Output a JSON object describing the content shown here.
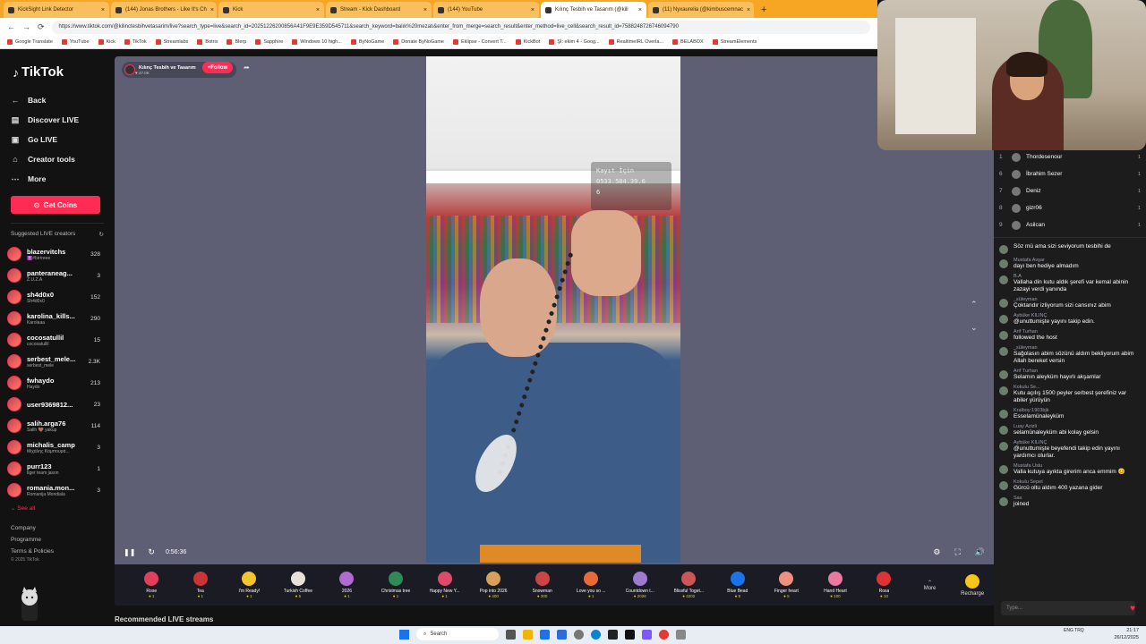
{
  "browser": {
    "tabs": [
      {
        "label": "KickSight Link Detector",
        "active": false
      },
      {
        "label": "(144) Jonas Brothers - Like It's Ch",
        "active": false
      },
      {
        "label": "Kick",
        "active": false
      },
      {
        "label": "Stream - Kick Dashboard",
        "active": false
      },
      {
        "label": "(144) YouTube",
        "active": false
      },
      {
        "label": "Kılınç Tesbih ve Tasarım (@kili",
        "active": true
      },
      {
        "label": "(11) Nyxaurelia (@kimbuscemnac",
        "active": false
      }
    ],
    "url": "https://www.tiktok.com/@kilinctesbihvetasarim/live?search_type=live&search_id=20251226200856A41F9E9E359D545711&search_keyword=balık%20mezatı&enter_from_merge=search_result&enter_method=live_cell&search_result_id=7588248726746094790",
    "bookmarks": [
      "Google Translate",
      "YouTube",
      "Kick",
      "TikTok",
      "Streamlabs",
      "Botrix",
      "Blerp",
      "Sapphire",
      "Windows 10 high...",
      "ByNoGame",
      "Donate ByNoGame",
      "Eklipse - Convert T...",
      "KickBot",
      "Şİ: ekim 4 - Goog...",
      "RealtimeIRL Overla...",
      "BELABOX",
      "StreamElements"
    ]
  },
  "sidebar": {
    "logo": "TikTok",
    "nav": [
      {
        "label": "Back",
        "icon": "arrow-left-icon",
        "glyph": "←"
      },
      {
        "label": "Discover LIVE",
        "icon": "live-icon",
        "glyph": "▤"
      },
      {
        "label": "Go LIVE",
        "icon": "camera-icon",
        "glyph": "▣"
      },
      {
        "label": "Creator tools",
        "icon": "home-icon",
        "glyph": "⌂"
      },
      {
        "label": "More",
        "icon": "more-icon",
        "glyph": "⋯"
      }
    ],
    "get_coins": "Get Coins",
    "suggested_title": "Suggested LIVE creators",
    "creators": [
      {
        "name": "blazervitchs",
        "sub": "✝️#birrreee",
        "count": "328"
      },
      {
        "name": "panteraneag...",
        "sub": "Z.U.Z.A",
        "count": "3"
      },
      {
        "name": "sh4d0x0",
        "sub": "Sh4d0x0",
        "count": "152"
      },
      {
        "name": "karolina_kills...",
        "sub": "Karolaaa",
        "count": "290"
      },
      {
        "name": "cocosatullil",
        "sub": "cocosatullil",
        "count": "15"
      },
      {
        "name": "serbest_mele...",
        "sub": "serbest_mele",
        "count": "2.3K"
      },
      {
        "name": "fwhaydo",
        "sub": "Haydo",
        "count": "213"
      },
      {
        "name": "user9369812...",
        "sub": "",
        "count": "23"
      },
      {
        "name": "salih.arga76",
        "sub": "Salih 🤎 yakup",
        "count": "114"
      },
      {
        "name": "michalis_camp",
        "sub": "Μιχάλης Καμπουρά...",
        "count": "3"
      },
      {
        "name": "purr123",
        "sub": "tiger team jason",
        "count": "1"
      },
      {
        "name": "romania.mon...",
        "sub": "Romanija Mondiala",
        "count": "3"
      }
    ],
    "see_all": "See all",
    "footer": [
      "Company",
      "Programme",
      "Terms & Policies"
    ],
    "copyright": "© 2025 TikTok"
  },
  "player": {
    "host_name": "Kılınç Tesbih ve Tasarım",
    "host_likes": "47.0K",
    "follow": "Follow",
    "overlay_lines": [
      "Kayıt İçin",
      "0533.584.39.6",
      "6"
    ],
    "timer": "0:56:36",
    "gifts": [
      {
        "name": "Rose",
        "price": "1",
        "color": "#e0405a"
      },
      {
        "name": "Tea",
        "price": "1",
        "color": "#c33"
      },
      {
        "name": "I'm Ready!",
        "price": "1",
        "color": "#f4c430"
      },
      {
        "name": "Turkish Coffee",
        "price": "5",
        "color": "#e8e2d8"
      },
      {
        "name": "2026",
        "price": "1",
        "color": "#b06ad0"
      },
      {
        "name": "Christmas tree",
        "price": "1",
        "color": "#2e8b57"
      },
      {
        "name": "Happy New Y...",
        "price": "1",
        "color": "#e04a6a"
      },
      {
        "name": "Pop into 2026",
        "price": "400",
        "color": "#d9a05b"
      },
      {
        "name": "Snowman",
        "price": "300",
        "color": "#c44"
      },
      {
        "name": "Love you so ...",
        "price": "1",
        "color": "#e86a3a"
      },
      {
        "name": "Countdown t...",
        "price": "2026",
        "color": "#a07ad0"
      },
      {
        "name": "Blissful Toget...",
        "price": "4202",
        "color": "#c55"
      },
      {
        "name": "Blue Bead",
        "price": "5",
        "color": "#1a73e8"
      },
      {
        "name": "Finger heart",
        "price": "5",
        "color": "#f09080"
      },
      {
        "name": "Hand Heart",
        "price": "100",
        "color": "#e87aa0"
      },
      {
        "name": "Rosa",
        "price": "10",
        "color": "#d33"
      }
    ],
    "more": "More",
    "recharge": "Recharge"
  },
  "recommended": "Recommended LIVE streams",
  "chat": {
    "viewers": [
      {
        "rank": "1",
        "name": "Thordesenour",
        "count": "1"
      },
      {
        "rank": "6",
        "name": "İbrahim Sezer",
        "count": "1"
      },
      {
        "rank": "7",
        "name": "Deniz",
        "count": "1"
      },
      {
        "rank": "8",
        "name": "gizr06",
        "count": "1"
      },
      {
        "rank": "9",
        "name": "Asilcan",
        "count": "1"
      }
    ],
    "messages": [
      {
        "name": "",
        "text": "Söz mü ama sizi seviyorum tesbihi de"
      },
      {
        "name": "Mustafa Avşar",
        "text": "dayı ben hediye almadım"
      },
      {
        "name": "B.A",
        "text": "Vallaha din kutu aldık şerefi var kemal abinin zazayi verdi yanında"
      },
      {
        "name": "_süleyman",
        "text": "Çoktandır izliyorum sizi cansınız abim"
      },
      {
        "name": "Aybüke KILINÇ",
        "text": "@unuttumişte yayını takip edin."
      },
      {
        "name": "Arif Turhan",
        "text": "followed the host"
      },
      {
        "name": "_süleyman",
        "text": "Sağolasın abim sözünü aldım bekliyorum abim Allah bereket versin"
      },
      {
        "name": "Arif Turhan",
        "text": "Selamın aleyküm hayırlı akşamlar"
      },
      {
        "name": "Kokulu Se...",
        "text": "Kutu açılış 1500 peyler serbest şerefiniz var abiler yürüyün"
      },
      {
        "name": "Kralboy:1903bjk",
        "text": "Esselamünaleyküm"
      },
      {
        "name": "Luay Azizli",
        "text": "selamünaleyküm abi kolay gelsin"
      },
      {
        "name": "Aybüke KILINÇ",
        "text": "@unuttumişte beyefendi takip edin yayını yardımcı olurlar."
      },
      {
        "name": "Mustafa Uslu",
        "text": "Valla kutuya ayıkta girerim anca emmim 😊"
      },
      {
        "name": "Kokulu Sepet",
        "text": "Gürcü oltu aldım 400 yazana gider"
      },
      {
        "name": "Sas",
        "text": "joined"
      }
    ],
    "input_placeholder": "Type..."
  },
  "taskbar": {
    "search": "Search",
    "lang": "ENG TRQ",
    "time": "21:17",
    "date": "26/12/2025"
  }
}
